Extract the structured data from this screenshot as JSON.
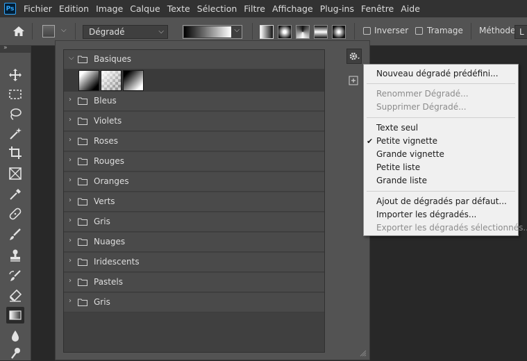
{
  "menubar": {
    "logo_text": "Ps",
    "items": [
      "Fichier",
      "Edition",
      "Image",
      "Calque",
      "Texte",
      "Sélection",
      "Filtre",
      "Affichage",
      "Plug-ins",
      "Fenêtre",
      "Aide"
    ]
  },
  "options": {
    "preset_dropdown": "Dégradé",
    "invert_label": "Inverser",
    "dither_label": "Tramage",
    "method_label": "Méthode :",
    "method_value": "L"
  },
  "panel": {
    "groups": [
      {
        "label": "Basiques",
        "expanded": true
      },
      {
        "label": "Bleus"
      },
      {
        "label": "Violets"
      },
      {
        "label": "Roses"
      },
      {
        "label": "Rouges"
      },
      {
        "label": "Oranges"
      },
      {
        "label": "Verts"
      },
      {
        "label": "Gris"
      },
      {
        "label": "Nuages"
      },
      {
        "label": "Iridescents"
      },
      {
        "label": "Pastels"
      },
      {
        "label": "Gris"
      }
    ]
  },
  "context_menu": {
    "items": [
      {
        "label": "Nouveau dégradé prédéfini...",
        "enabled": true
      },
      {
        "label": "Renommer Dégradé...",
        "enabled": false
      },
      {
        "label": "Supprimer Dégradé...",
        "enabled": false
      },
      {
        "label": "Texte seul",
        "enabled": true
      },
      {
        "label": "Petite vignette",
        "enabled": true,
        "checked": true
      },
      {
        "label": "Grande vignette",
        "enabled": true
      },
      {
        "label": "Petite liste",
        "enabled": true
      },
      {
        "label": "Grande liste",
        "enabled": true
      },
      {
        "label": "Ajout de dégradés par défaut...",
        "enabled": true
      },
      {
        "label": "Importer les dégradés...",
        "enabled": true
      },
      {
        "label": "Exporter les dégradés sélectionnés...",
        "enabled": false
      }
    ],
    "check_mark": "✔"
  },
  "colors": {
    "accent": "#31a8ff",
    "panel_bg": "#535353",
    "menu_bg": "#f0f0f0"
  }
}
